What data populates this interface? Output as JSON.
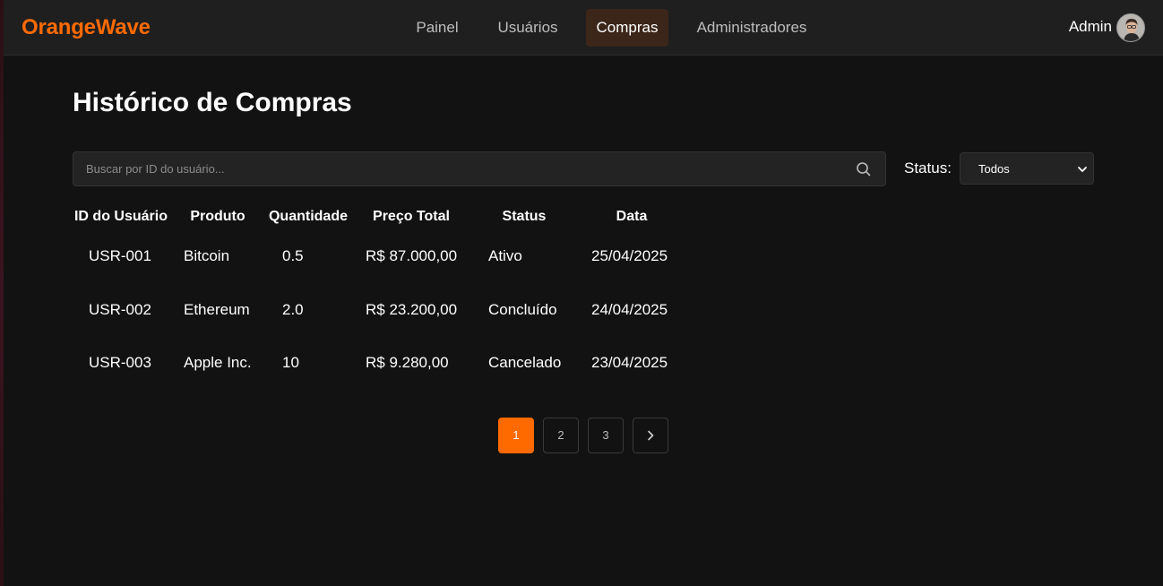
{
  "header": {
    "brand": "OrangeWave",
    "nav": [
      {
        "label": "Painel",
        "active": false
      },
      {
        "label": "Usuários",
        "active": false
      },
      {
        "label": "Compras",
        "active": true
      },
      {
        "label": "Administradores",
        "active": false
      }
    ],
    "user_name": "Admin",
    "avatar_icon": "user-avatar"
  },
  "main": {
    "title": "Histórico de Compras",
    "search": {
      "placeholder": "Buscar por ID do usuário...",
      "value": "",
      "icon": "search-icon"
    },
    "status_filter": {
      "label": "Status:",
      "selected": "Todos",
      "icon": "chevron-down-icon"
    }
  },
  "table": {
    "headers": [
      "ID do Usuário",
      "Produto",
      "Quantidade",
      "Preço Total",
      "Status",
      "Data"
    ],
    "rows": [
      {
        "id": "USR-001",
        "product": "Bitcoin",
        "qty": "0.5",
        "price": "R$ 87.000,00",
        "status": "Ativo",
        "date": "25/04/2025"
      },
      {
        "id": "USR-002",
        "product": "Ethereum",
        "qty": "2.0",
        "price": "R$ 23.200,00",
        "status": "Concluído",
        "date": "24/04/2025"
      },
      {
        "id": "USR-003",
        "product": "Apple Inc.",
        "qty": "10",
        "price": "R$ 9.280,00",
        "status": "Cancelado",
        "date": "23/04/2025"
      }
    ]
  },
  "pagination": {
    "pages": [
      "1",
      "2",
      "3"
    ],
    "current": 1,
    "next_icon": "chevron-right-icon"
  },
  "colors": {
    "accent": "#ff6a00",
    "background": "#121212",
    "header_bg": "#1f1f1f",
    "active_nav_bg": "#3b2619"
  }
}
